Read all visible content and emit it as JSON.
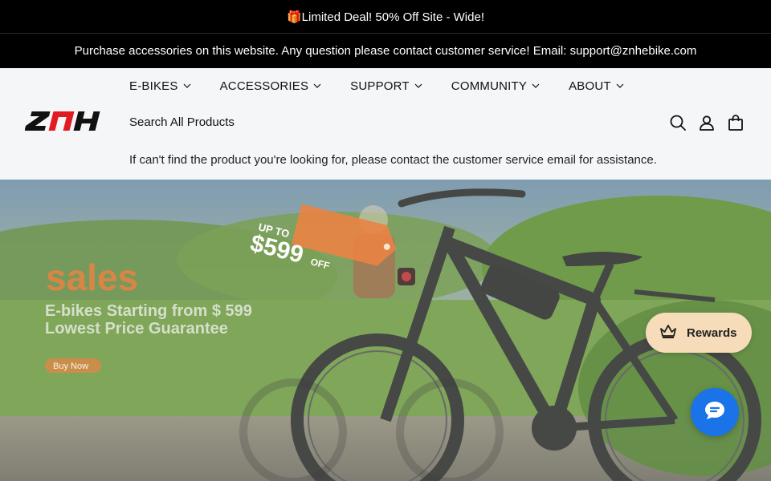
{
  "announcement": {
    "text": "🎁Limited Deal!  50% Off Site - Wide!"
  },
  "info_bar": {
    "text": "Purchase accessories on this website. Any question please contact customer service! Email: support@znhebike.com"
  },
  "nav": {
    "items": [
      {
        "label": "E-BIKES"
      },
      {
        "label": "ACCESSORIES"
      },
      {
        "label": "SUPPORT"
      },
      {
        "label": "COMMUNITY"
      },
      {
        "label": "ABOUT"
      }
    ]
  },
  "logo": {
    "text": "ZNH"
  },
  "search": {
    "label": "Search All Products"
  },
  "help": {
    "text": "If can't find the product you're looking for, please contact the customer service email for assistance."
  },
  "header_icons": [
    "search-icon",
    "account-icon",
    "cart-icon"
  ],
  "hero": {
    "tag_small": "UP TO",
    "tag_price": "$599",
    "tag_suffix": "OFF",
    "headline": "sales",
    "line1": "E-bikes Starting from $ 599",
    "line2": "Lowest Price Guarantee",
    "button": "Buy Now"
  },
  "rewards": {
    "label": "Rewards"
  },
  "colors": {
    "topbar": "#000000",
    "header_bg": "#f5f6f8",
    "rewards_bg": "#f6dcb8",
    "chat_bg": "#1a73e8",
    "sale_orange": "#e8722a",
    "logo_red": "#e21b23"
  }
}
